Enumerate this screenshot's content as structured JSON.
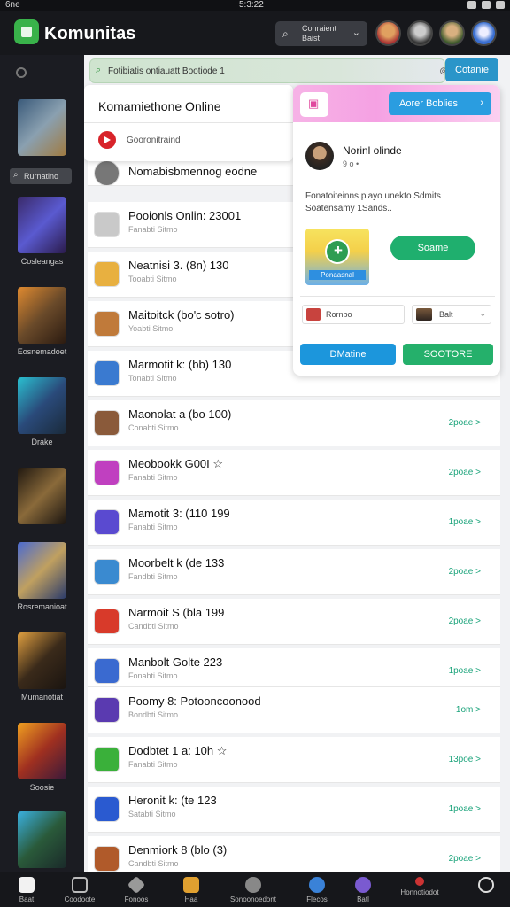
{
  "status": {
    "left": "6ne",
    "time": "5:3:22"
  },
  "app": {
    "title": "Komunitas"
  },
  "top_select": {
    "line1": "Conraient",
    "line2": "Baist"
  },
  "top_icons": [
    "fire-icon",
    "user-icon"
  ],
  "sidebar": {
    "chip": "Rurnatino",
    "items": [
      {
        "label": ""
      },
      {
        "label": "Cosleangas"
      },
      {
        "label": "Eosnemadoet"
      },
      {
        "label": "Drake"
      },
      {
        "label": ""
      },
      {
        "label": "Rosremanioat"
      },
      {
        "label": "Mumanotiat"
      },
      {
        "label": "Soosie"
      },
      {
        "label": ""
      }
    ]
  },
  "search": {
    "placeholder": "Fotibiatis ontiauatt Bootiode 1",
    "button": "Cotanie"
  },
  "panel_left": {
    "title": "Komamiethone Online",
    "sub": "Gooronitraind"
  },
  "rows": [
    {
      "name": "Nomabisbmennog eodne",
      "sub": "",
      "action": ""
    },
    {
      "name": "Pooionls Onlin: 23001",
      "sub": "Fanabti Sitmo",
      "action": ""
    },
    {
      "name": "Neatnisi 3. (8n) 130",
      "sub": "Tooabti Sitmo",
      "action": ""
    },
    {
      "name": "Maitoitck (bo'c sotro)",
      "sub": "Yoabti Sitmo",
      "action": ""
    },
    {
      "name": "Marmotit k: (bb) 130",
      "sub": "Tonabti Sitmo",
      "action": ""
    },
    {
      "name": "Maonolat a (bo 100)",
      "sub": "Conabti Sitmo",
      "action": "2poae >"
    },
    {
      "name": "Meobookk G00I ☆",
      "sub": "Fanabti Sitmo",
      "action": "2poae >"
    },
    {
      "name": "Mamotit 3: (110 199",
      "sub": "Fanabti Sitmo",
      "action": "1poae >"
    },
    {
      "name": "Moorbelt k (de 133",
      "sub": "Fandbti Sitmo",
      "action": "2poae >"
    },
    {
      "name": "Narmoit S (bla 199",
      "sub": "Candbti Sitmo",
      "action": "2poae >"
    },
    {
      "name": "Manbolt Golte 223",
      "sub": "Fonabti Sitmo",
      "action": "1poae >"
    },
    {
      "name": "Poomy 8: Potooncoonood",
      "sub": "Bondbti Sitmo",
      "action": "1om >"
    },
    {
      "name": "Dodbtet 1 a: 10h ☆",
      "sub": "Fanabti Sitmo",
      "action": "13poe >"
    },
    {
      "name": "Heronit k: (te 123",
      "sub": "Satabti Sitmo",
      "action": "1poae >"
    },
    {
      "name": "Denmiork 8 (blo (3)",
      "sub": "Candbti Sitmo",
      "action": "2poae >"
    }
  ],
  "panel_right": {
    "banner_button": "Aorer  Boblies",
    "name": "Norinl olinde",
    "stat": "9 o •",
    "desc1": "Fonatoiteinns piayo unekto Sdmits",
    "desc2": "Soatensamy 1Sands..",
    "card_label": "Ponaasnal",
    "green_button": "Soame",
    "select1": "Rornbo",
    "select2": "Balt",
    "button1": "DMatine",
    "button2": "SOOTORE"
  },
  "bottom_nav": [
    {
      "label": "Baat"
    },
    {
      "label": "Coodoote"
    },
    {
      "label": "Fonoos"
    },
    {
      "label": "Haa"
    },
    {
      "label": "Sonoonoedont"
    },
    {
      "label": "Flecos"
    },
    {
      "label": "Batl"
    },
    {
      "label": "Honnotiodot"
    },
    {
      "label": ""
    }
  ],
  "colors": {
    "accent": "#2a95c9",
    "green": "#1faf6e",
    "pink": "#f5a1e3"
  }
}
